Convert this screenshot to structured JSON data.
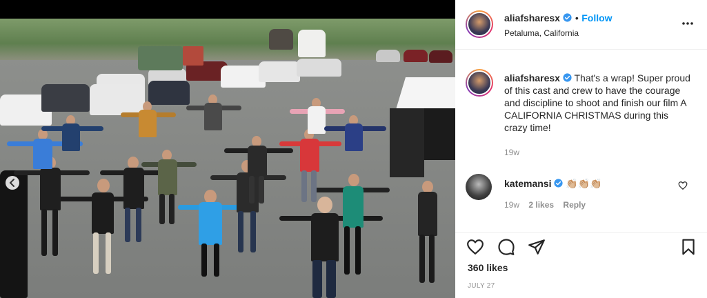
{
  "post": {
    "author": {
      "username": "aliafsharesx",
      "verified": true,
      "follow_label": "Follow",
      "separator": "•",
      "location": "Petaluma, California"
    },
    "caption": {
      "username": "aliafsharesx",
      "text": "That's a wrap! Super proud of this cast and crew to have the courage and discipline to shoot and finish our film A CALIFORNIA CHRISTMAS during this crazy time!",
      "age": "19w"
    },
    "comments": [
      {
        "username": "katemansi",
        "verified": true,
        "text": "👏🏼👏🏼👏🏼",
        "age": "19w",
        "likes": "2 likes",
        "reply_label": "Reply"
      }
    ],
    "likes": "360 likes",
    "date": "JULY 27"
  },
  "icons": {
    "more": "more-options-icon",
    "like": "heart-icon",
    "comment": "comment-icon",
    "share": "share-icon",
    "save": "bookmark-icon",
    "comment_like": "small-heart-icon",
    "verified": "verified-badge-icon",
    "photo_prev": "chevron-left-icon"
  },
  "colors": {
    "accent": "#0095f6",
    "text": "#262626",
    "muted": "#8e8e8e",
    "divider": "#efefef"
  }
}
